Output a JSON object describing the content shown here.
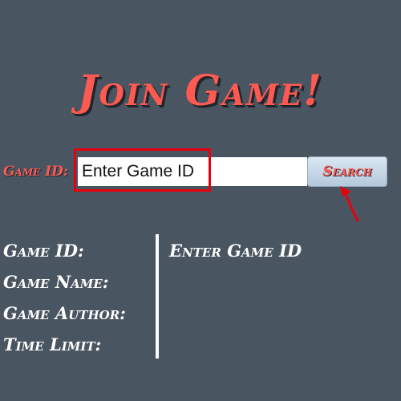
{
  "title": "Join Game!",
  "search": {
    "label": "Game ID:",
    "input_value": "",
    "placeholder": "Enter Game ID",
    "button_label": "Search"
  },
  "details": {
    "labels": [
      "Game ID:",
      "Game Name:",
      "Game Author:",
      "Time Limit:"
    ],
    "value_text": "Enter Game ID"
  },
  "annotations": {
    "highlight_color": "#e8000d",
    "arrow_color": "#e8000d"
  },
  "colors": {
    "background": "#4a5562",
    "accent": "#ff5a52",
    "text": "#ffffff"
  }
}
